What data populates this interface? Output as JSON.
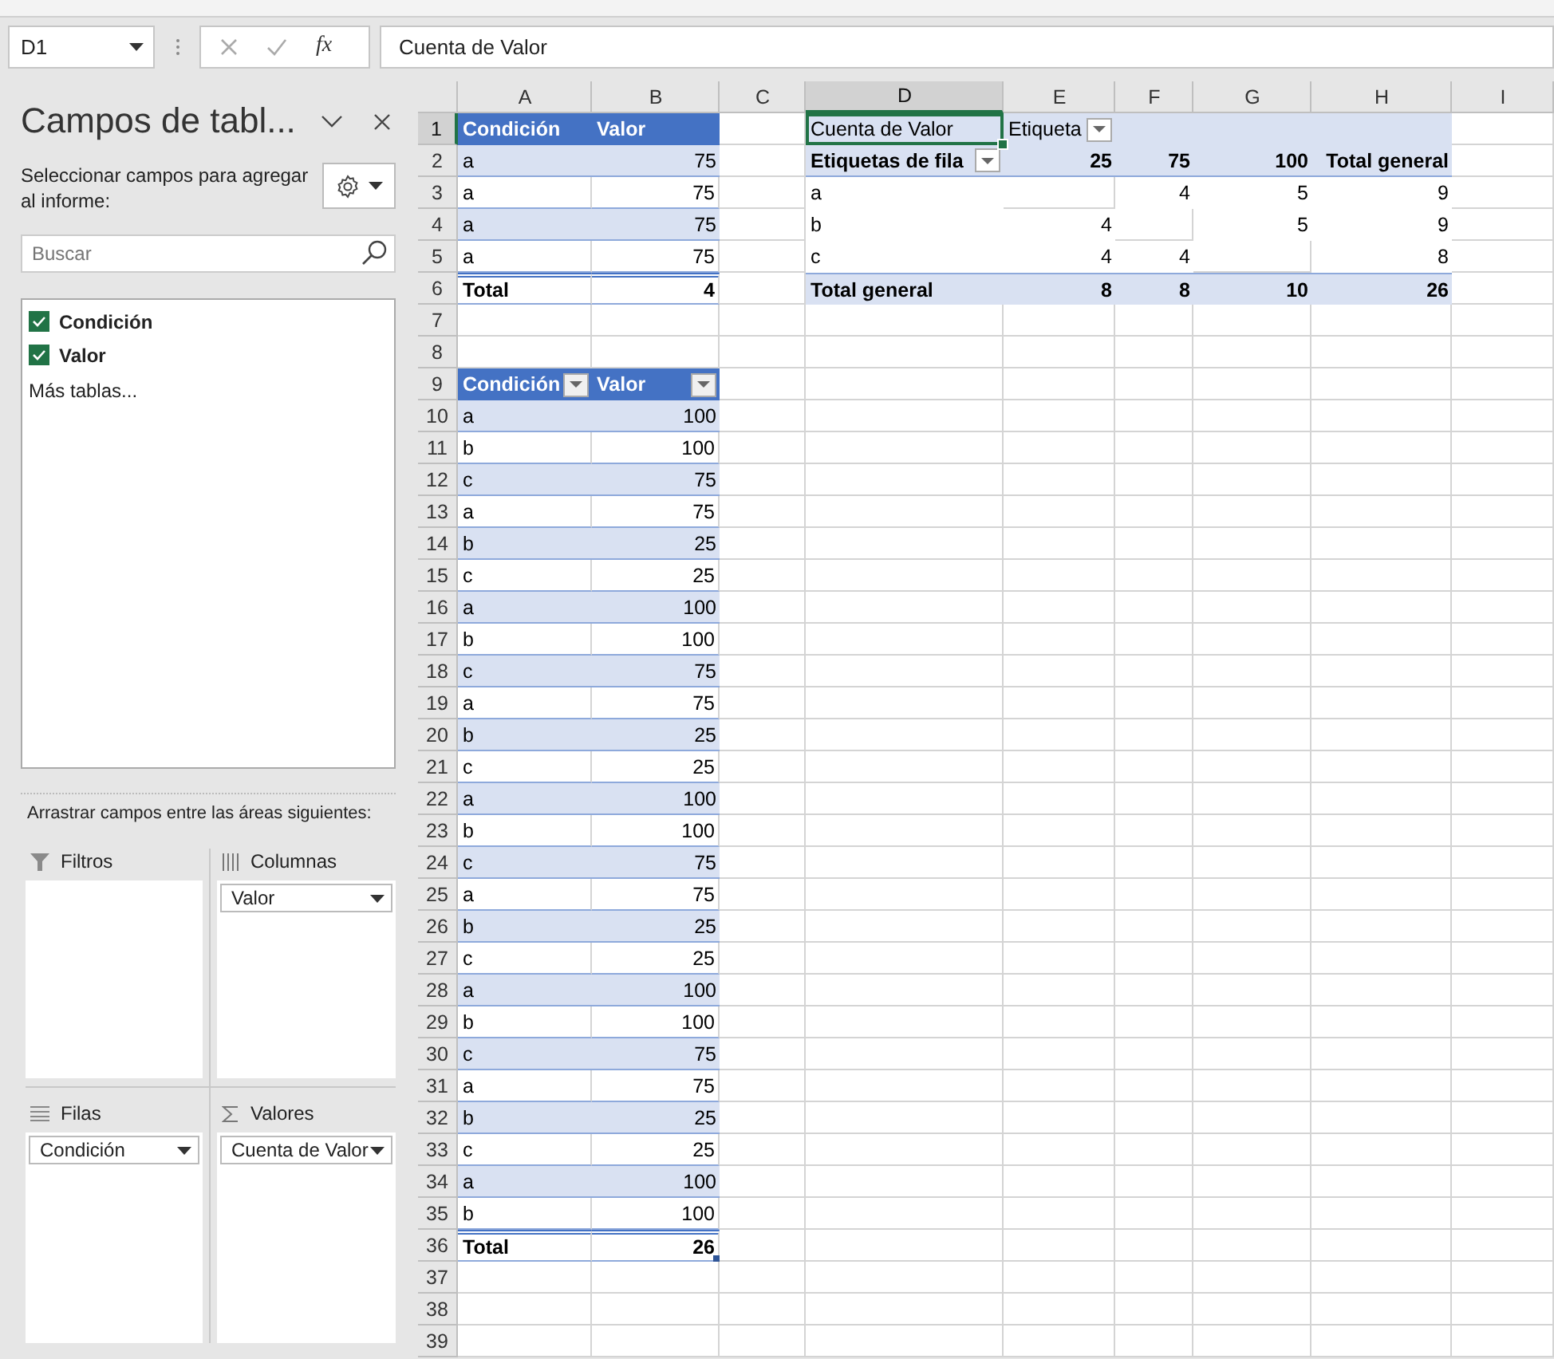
{
  "formula_bar": {
    "name_box": "D1",
    "function_button": "fx",
    "formula": "Cuenta de Valor"
  },
  "field_pane": {
    "title": "Campos de tabl...",
    "instructions": "Seleccionar campos para agregar al informe:",
    "search": {
      "placeholder": "Buscar"
    },
    "fields": [
      {
        "label": "Condición",
        "checked": true
      },
      {
        "label": "Valor",
        "checked": true
      }
    ],
    "more_tables": "Más tablas...",
    "drag_hint": "Arrastrar campos entre las áreas siguientes:",
    "areas": [
      {
        "kind": "filters",
        "title": "Filtros"
      },
      {
        "kind": "columns",
        "title": "Columnas",
        "items": [
          "Valor"
        ]
      },
      {
        "kind": "rows",
        "title": "Filas",
        "items": [
          "Condición"
        ]
      },
      {
        "kind": "values",
        "title": "Valores",
        "items": [
          "Cuenta de Valor"
        ]
      }
    ]
  },
  "sheet": {
    "columns": [
      {
        "label": "A",
        "selected": false
      },
      {
        "label": "B",
        "selected": false
      },
      {
        "label": "C",
        "selected": false
      },
      {
        "label": "D",
        "selected": true
      },
      {
        "label": "E",
        "selected": false
      },
      {
        "label": "F",
        "selected": false
      },
      {
        "label": "G",
        "selected": false
      },
      {
        "label": "H",
        "selected": false
      },
      {
        "label": "I",
        "selected": false
      }
    ],
    "row_numbers": [
      {
        "label": "1",
        "selected": true
      },
      {
        "label": "2",
        "selected": false
      },
      {
        "label": "3",
        "selected": false
      },
      {
        "label": "4",
        "selected": false
      },
      {
        "label": "5",
        "selected": false
      },
      {
        "label": "6",
        "selected": false
      },
      {
        "label": "7",
        "selected": false
      },
      {
        "label": "8",
        "selected": false
      },
      {
        "label": "9",
        "selected": false
      },
      {
        "label": "10",
        "selected": false
      },
      {
        "label": "11",
        "selected": false
      },
      {
        "label": "12",
        "selected": false
      },
      {
        "label": "13",
        "selected": false
      },
      {
        "label": "14",
        "selected": false
      },
      {
        "label": "15",
        "selected": false
      },
      {
        "label": "16",
        "selected": false
      },
      {
        "label": "17",
        "selected": false
      },
      {
        "label": "18",
        "selected": false
      },
      {
        "label": "19",
        "selected": false
      },
      {
        "label": "20",
        "selected": false
      },
      {
        "label": "21",
        "selected": false
      },
      {
        "label": "22",
        "selected": false
      },
      {
        "label": "23",
        "selected": false
      },
      {
        "label": "24",
        "selected": false
      },
      {
        "label": "25",
        "selected": false
      },
      {
        "label": "26",
        "selected": false
      },
      {
        "label": "27",
        "selected": false
      },
      {
        "label": "28",
        "selected": false
      },
      {
        "label": "29",
        "selected": false
      },
      {
        "label": "30",
        "selected": false
      },
      {
        "label": "31",
        "selected": false
      },
      {
        "label": "32",
        "selected": false
      },
      {
        "label": "33",
        "selected": false
      },
      {
        "label": "34",
        "selected": false
      },
      {
        "label": "35",
        "selected": false
      },
      {
        "label": "36",
        "selected": false
      },
      {
        "label": "37",
        "selected": false
      },
      {
        "label": "38",
        "selected": false
      },
      {
        "label": "39",
        "selected": false
      }
    ],
    "tables": [
      {
        "header": [
          "Condición",
          "Valor"
        ],
        "filter_buttons": false,
        "rows": [
          [
            "a",
            "75"
          ],
          [
            "a",
            "75"
          ],
          [
            "a",
            "75"
          ],
          [
            "a",
            "75"
          ]
        ],
        "total": [
          "Total",
          "4"
        ]
      },
      {
        "header": [
          "Condición",
          "Valor"
        ],
        "filter_buttons": true,
        "rows": [
          [
            "a",
            "100"
          ],
          [
            "b",
            "100"
          ],
          [
            "c",
            "75"
          ],
          [
            "a",
            "75"
          ],
          [
            "b",
            "25"
          ],
          [
            "c",
            "25"
          ],
          [
            "a",
            "100"
          ],
          [
            "b",
            "100"
          ],
          [
            "c",
            "75"
          ],
          [
            "a",
            "75"
          ],
          [
            "b",
            "25"
          ],
          [
            "c",
            "25"
          ],
          [
            "a",
            "100"
          ],
          [
            "b",
            "100"
          ],
          [
            "c",
            "75"
          ],
          [
            "a",
            "75"
          ],
          [
            "b",
            "25"
          ],
          [
            "c",
            "25"
          ],
          [
            "a",
            "100"
          ],
          [
            "b",
            "100"
          ],
          [
            "c",
            "75"
          ],
          [
            "a",
            "75"
          ],
          [
            "b",
            "25"
          ],
          [
            "c",
            "25"
          ],
          [
            "a",
            "100"
          ],
          [
            "b",
            "100"
          ]
        ],
        "total": [
          "Total",
          "26"
        ]
      }
    ],
    "pivot": {
      "rows": [
        {
          "kind": "filter",
          "cells": [
            "Cuenta de Valor",
            "Etiqueta",
            null,
            null,
            null
          ],
          "filter_cells": [
            false,
            true,
            false,
            false,
            false
          ]
        },
        {
          "kind": "header",
          "cells": [
            "Etiquetas de fila",
            "25",
            "75",
            "100",
            "Total general"
          ],
          "filter_cells": [
            true,
            false,
            false,
            false,
            false
          ]
        },
        {
          "kind": "data",
          "cells": [
            "a",
            null,
            "4",
            "5",
            "9"
          ]
        },
        {
          "kind": "data",
          "cells": [
            "b",
            "4",
            null,
            "5",
            "9"
          ]
        },
        {
          "kind": "data",
          "cells": [
            "c",
            "4",
            "4",
            null,
            "8"
          ]
        },
        {
          "kind": "total",
          "cells": [
            "Total general",
            "8",
            "8",
            "10",
            "26"
          ]
        }
      ]
    }
  }
}
